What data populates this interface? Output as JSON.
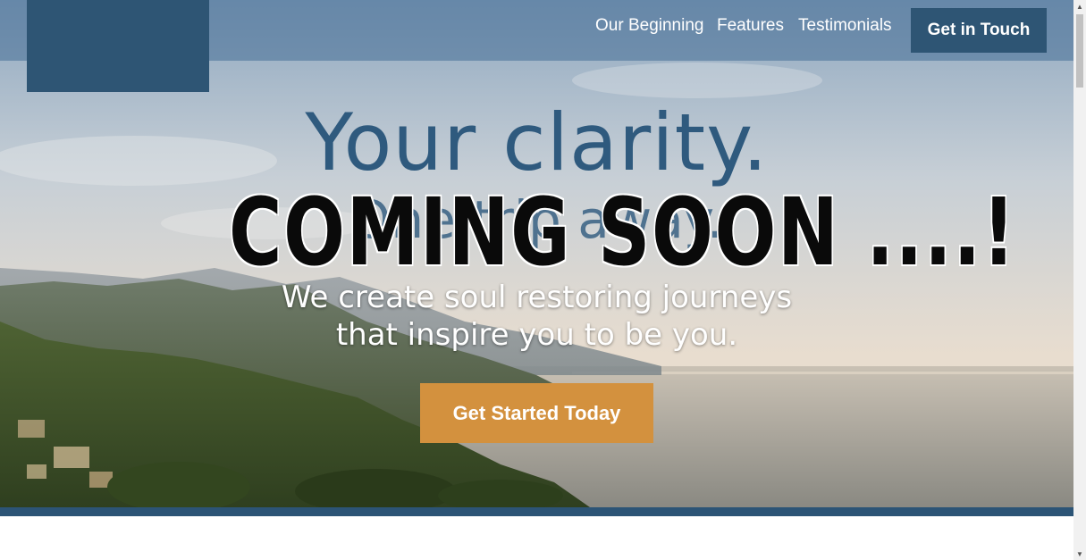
{
  "nav": {
    "links": [
      "Our Beginning",
      "Features",
      "Testimonials"
    ],
    "cta_label": "Get in Touch"
  },
  "hero": {
    "headline_1": "Your clarity.",
    "headline_2": "One trip away.",
    "overlay_text": "COMING SOON ....!",
    "tagline_line1": "We create soul restoring journeys",
    "tagline_line2": "that inspire you to be you.",
    "cta_label": "Get Started Today"
  },
  "colors": {
    "brand_blue": "#2e5574",
    "accent_orange": "#d3913e",
    "headline_blue": "#2f5a7e"
  },
  "icons": {
    "scroll_up": "scroll-up-arrow-icon",
    "scroll_down": "scroll-down-arrow-icon"
  }
}
